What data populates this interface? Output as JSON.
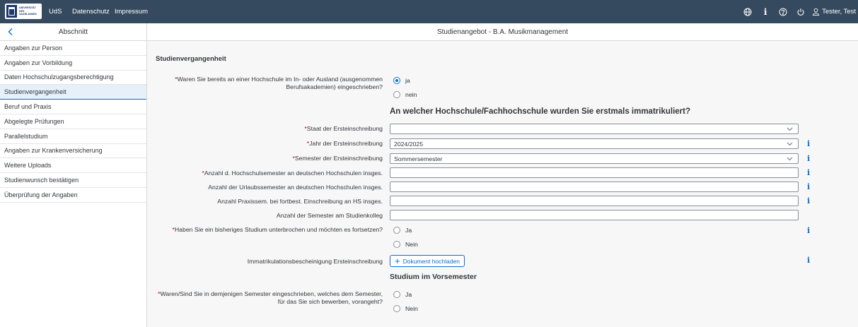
{
  "topbar": {
    "logo_text": "UNIVERSITÄT\nDES\nSAARLANDES",
    "links": [
      "UdS",
      "Datenschutz",
      "Impressum"
    ],
    "icons": [
      "globe-icon",
      "info-icon",
      "help-icon",
      "power-icon",
      "user-icon"
    ],
    "user_name": "Tester, Test"
  },
  "sidebar": {
    "title": "Abschnitt",
    "items": [
      {
        "label": "Angaben zur Person",
        "active": false
      },
      {
        "label": "Angaben zur Vorbildung",
        "active": false
      },
      {
        "label": "Daten Hochschulzugangsberechtigung",
        "active": false
      },
      {
        "label": "Studienvergangenheit",
        "active": true
      },
      {
        "label": "Beruf und Praxis",
        "active": false
      },
      {
        "label": "Abgelegte Prüfungen",
        "active": false
      },
      {
        "label": "Parallelstudium",
        "active": false
      },
      {
        "label": "Angaben zur Krankenversicherung",
        "active": false
      },
      {
        "label": "Weitere Uploads",
        "active": false
      },
      {
        "label": "Studienwunsch bestätigen",
        "active": false
      },
      {
        "label": "Überprüfung der Angaben",
        "active": false
      }
    ]
  },
  "main": {
    "page_title": "Studienangebot - B.A. Musikmanagement",
    "section_title": "Studienvergangenheit",
    "q1": {
      "required": "*",
      "label_line1": "Waren Sie bereits an einer Hochschule im In- oder Ausland (ausgenommen",
      "label_line2": "Berufsakademien) eingeschrieben?",
      "options": [
        "ja",
        "nein"
      ],
      "selected": "ja"
    },
    "heading1": "An welcher Hochschule/Fachhochschule wurden Sie erstmals immatrikuliert?",
    "fields": {
      "staat": {
        "required": "*",
        "label": "Staat der Ersteinschreibung",
        "value": ""
      },
      "jahr": {
        "required": "*",
        "label": "Jahr der Ersteinschreibung",
        "value": "2024/2025"
      },
      "semester": {
        "required": "*",
        "label": "Semester der Ersteinschreibung",
        "value": "Sommersemester"
      },
      "anzahl_hs": {
        "required": "*",
        "label": "Anzahl d. Hochschulsemester an deutschen Hochschulen insges.",
        "value": ""
      },
      "urlaub": {
        "label": "Anzahl der Urlaubssemester an deutschen Hochschulen insges.",
        "value": ""
      },
      "praxis": {
        "label": "Anzahl Praxissem. bei fortbest. Einschreibung an HS insges.",
        "value": ""
      },
      "kolleg": {
        "label": "Anzahl der Semester am Studienkolleg",
        "value": ""
      }
    },
    "q2": {
      "required": "*",
      "label": "Haben Sie ein bisheriges Studium unterbrochen und möchten es fortsetzen?",
      "options": [
        "Ja",
        "Nein"
      ]
    },
    "upload": {
      "label": "Immatrikulationsbescheinigung Ersteinschreibung",
      "button": "Dokument hochladen"
    },
    "heading2": "Studium im Vorsemester",
    "q3": {
      "required": "*",
      "label_line1": "Waren/Sind Sie in demjenigen Semester eingeschrieben, welches dem Semester,",
      "label_line2": "für das Sie sich bewerben, vorangeht?",
      "options": [
        "Ja",
        "Nein"
      ]
    },
    "info_glyph": "i"
  },
  "colors": {
    "topbar": "#354a5f",
    "accent": "#0a6ed1",
    "required": "#bb0000",
    "active_item_bg": "#e5f0fa"
  }
}
